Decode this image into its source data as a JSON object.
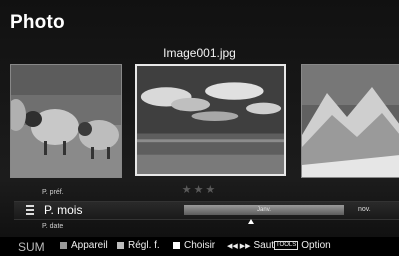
{
  "header": {
    "title": "Photo"
  },
  "viewer": {
    "filename": "Image001.jpg",
    "rating_stars": "★★★"
  },
  "sort": {
    "prev_option": "P. préf.",
    "current": "P. mois",
    "next_option": "P. date",
    "timeline_label": "Janv.",
    "timeline_next": "nov."
  },
  "footer": {
    "sum": "SUM",
    "appareil": "Appareil",
    "regl": "Régl. f.",
    "choisir": "Choisir",
    "saut_arrows": "◀◀ ▶▶",
    "saut": "Saut",
    "tools_badge": "TOOLS",
    "option": "Option"
  },
  "colors": {
    "background": "#000000",
    "text": "#ffffff",
    "selected_border": "#e8e8e8",
    "timeline_bar": "#7a7a7a"
  },
  "icons": [
    "sort-list-icon",
    "timeline-marker-icon",
    "tools-icon"
  ]
}
